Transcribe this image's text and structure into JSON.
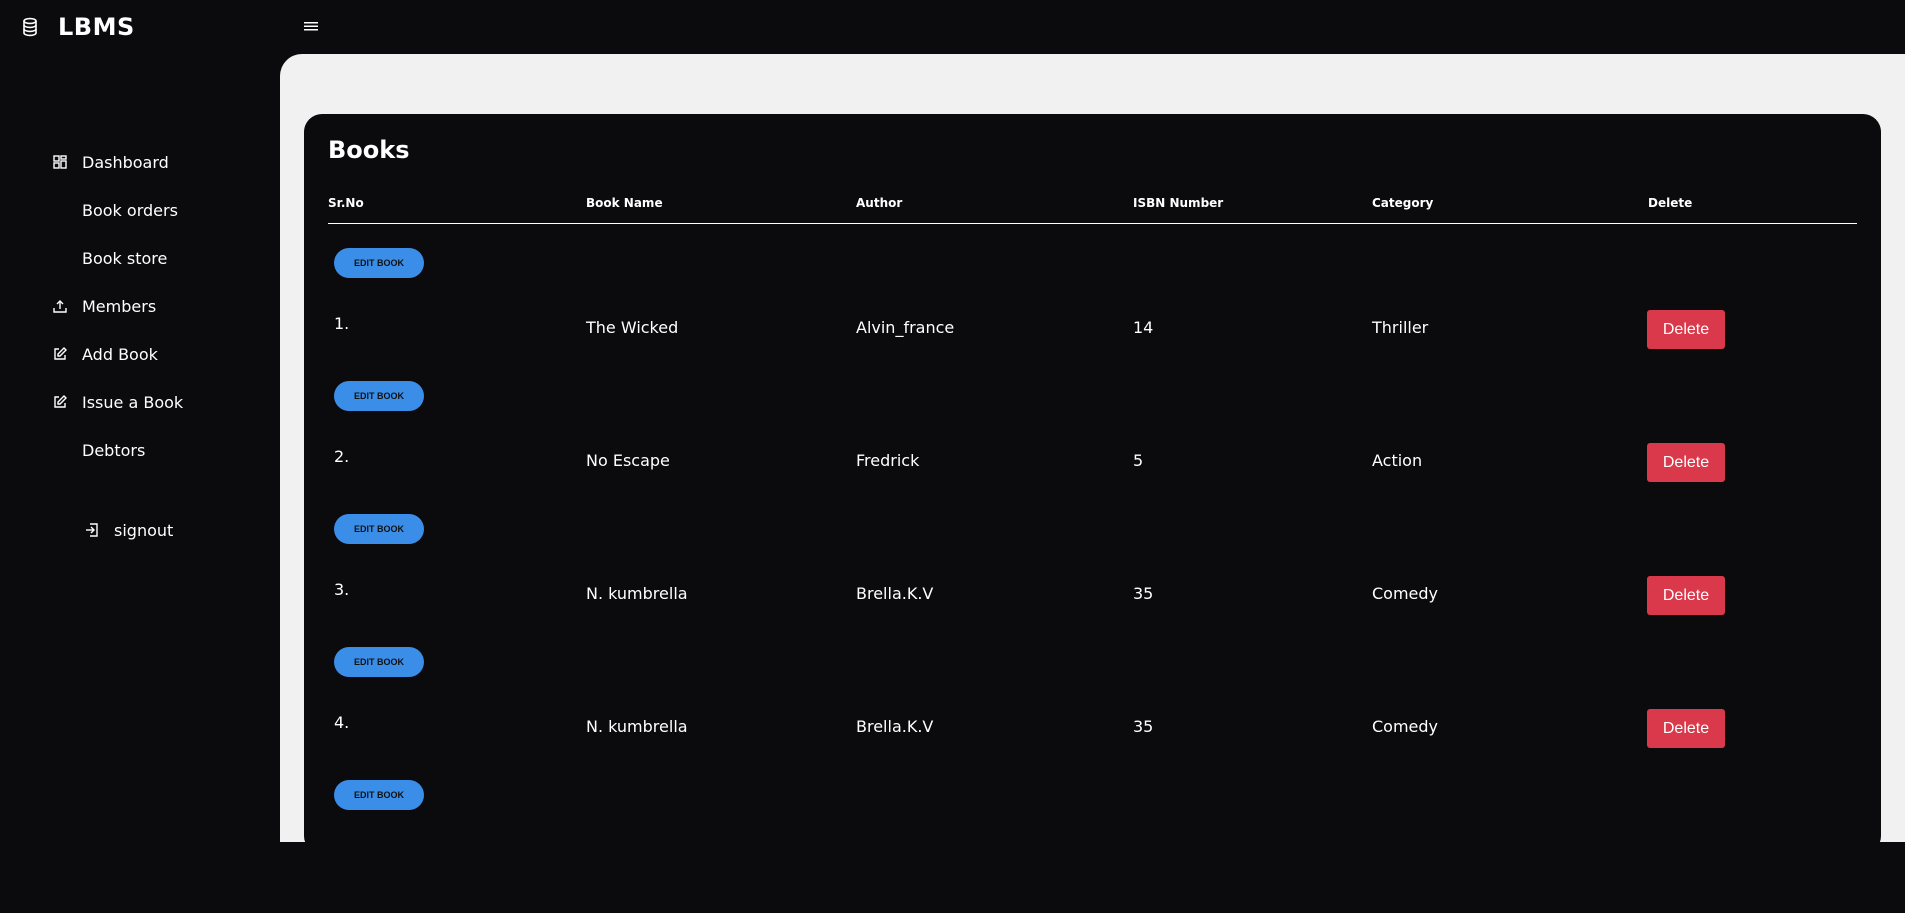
{
  "app": {
    "title": "LBMS"
  },
  "sidebar": {
    "items": [
      {
        "label": "Dashboard",
        "icon": "dashboard-icon"
      },
      {
        "label": "Book orders",
        "icon": ""
      },
      {
        "label": "Book store",
        "icon": ""
      },
      {
        "label": "Members",
        "icon": "upload-icon"
      },
      {
        "label": "Add Book",
        "icon": "edit-icon"
      },
      {
        "label": "Issue a Book",
        "icon": "edit-icon"
      },
      {
        "label": "Debtors",
        "icon": ""
      }
    ],
    "signout": {
      "label": "signout",
      "icon": "signout-icon"
    }
  },
  "books": {
    "title": "Books",
    "columns": [
      "Sr.No",
      "Book Name",
      "Author",
      "ISBN Number",
      "Category",
      "Delete"
    ],
    "edit_label": "EDIT BOOK",
    "delete_label": "Delete",
    "rows": [
      {
        "srno": "1.",
        "name": "The Wicked",
        "author": "Alvin_france",
        "isbn": "14",
        "category": "Thriller"
      },
      {
        "srno": "2.",
        "name": "No Escape",
        "author": "Fredrick",
        "isbn": "5",
        "category": "Action"
      },
      {
        "srno": "3.",
        "name": "N. kumbrella",
        "author": "Brella.K.V",
        "isbn": "35",
        "category": "Comedy"
      },
      {
        "srno": "4.",
        "name": "N. kumbrella",
        "author": "Brella.K.V",
        "isbn": "35",
        "category": "Comedy"
      }
    ]
  },
  "colors": {
    "background": "#0b0a0c",
    "content": "#f1f1f1",
    "edit_button": "#3a8ee8",
    "delete_button": "#d9394a"
  }
}
